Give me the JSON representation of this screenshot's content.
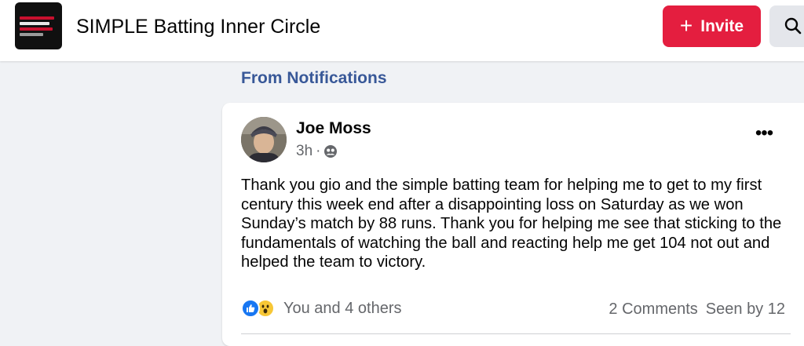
{
  "header": {
    "group_name": "SIMPLE Batting Inner Circle",
    "invite_label": "Invite",
    "accent_color": "#e41e3f"
  },
  "feed": {
    "section_label": "From Notifications"
  },
  "post": {
    "author": "Joe Moss",
    "time": "3h",
    "separator": "·",
    "audience_icon": "group-audience-icon",
    "text": "Thank you gio and the simple batting team for helping me to get to my first century this week end after a disappointing loss on Saturday as we won Sunday’s match by 88 runs. Thank you for helping me see that sticking to the fundamentals of watching the ball and reacting help me get 104 not out and helped the team to victory.",
    "reactions": {
      "icons": [
        "like-icon",
        "wow-icon"
      ],
      "summary": "You and 4 others"
    },
    "comments_label": "2 Comments",
    "seen_label": "Seen by 12"
  }
}
